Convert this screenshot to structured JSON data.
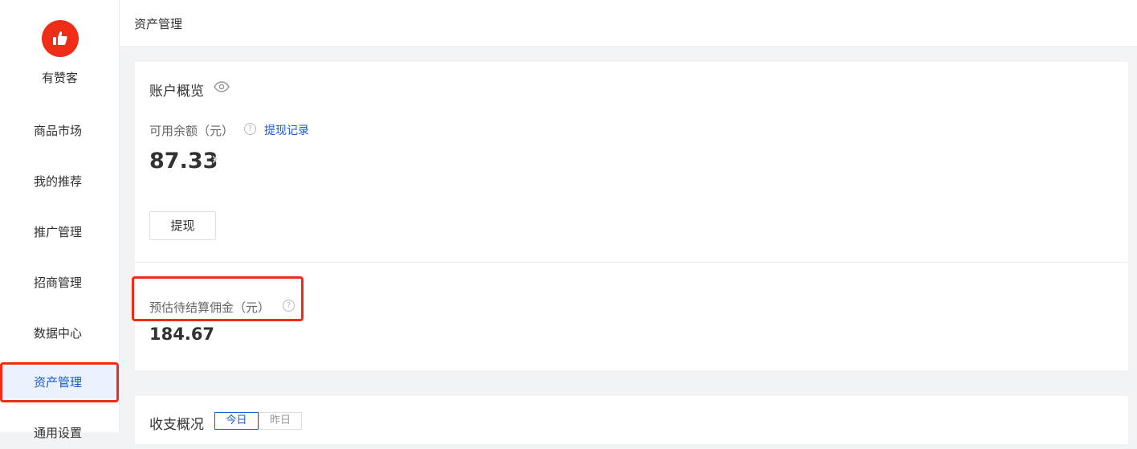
{
  "sidebar": {
    "brand": "有赞客",
    "items": [
      {
        "label": "商品市场",
        "active": false
      },
      {
        "label": "我的推荐",
        "active": false
      },
      {
        "label": "推广管理",
        "active": false
      },
      {
        "label": "招商管理",
        "active": false
      },
      {
        "label": "数据中心",
        "active": false
      },
      {
        "label": "资产管理",
        "active": true
      },
      {
        "label": "通用设置",
        "active": false
      }
    ]
  },
  "header": {
    "breadcrumb": "资产管理"
  },
  "account_overview": {
    "title": "账户概览",
    "balance_label": "可用余额（元）",
    "withdraw_record_link": "提现记录",
    "balance_value": "87.33",
    "withdraw_button": "提现",
    "pending_label": "预估待结算佣金（元）",
    "pending_value": "184.67"
  },
  "income_overview": {
    "title": "收支概况",
    "tabs": [
      {
        "label": "今日",
        "selected": true
      },
      {
        "label": "昨日",
        "selected": false
      }
    ]
  },
  "colors": {
    "accent": "#155bd4",
    "brand": "#ee2c18",
    "highlight": "#ee2c18"
  }
}
